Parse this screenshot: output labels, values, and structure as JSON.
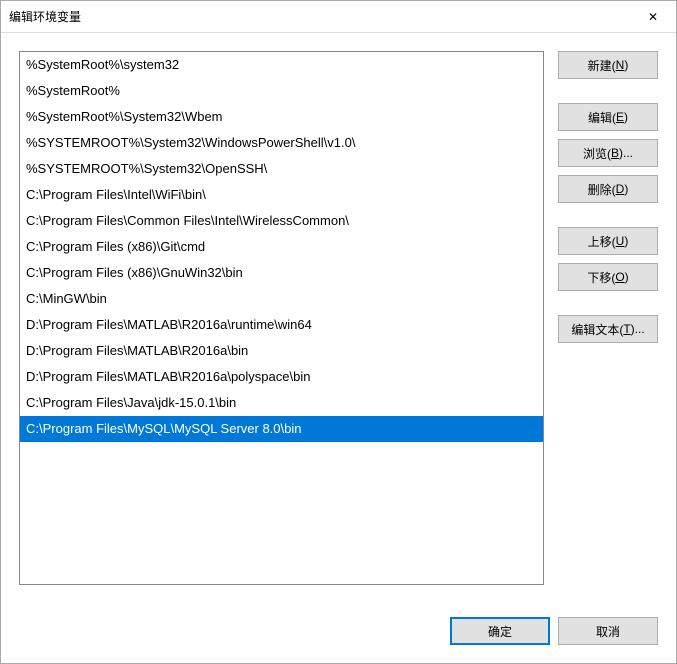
{
  "title": "编辑环境变量",
  "list": [
    "%SystemRoot%\\system32",
    "%SystemRoot%",
    "%SystemRoot%\\System32\\Wbem",
    "%SYSTEMROOT%\\System32\\WindowsPowerShell\\v1.0\\",
    "%SYSTEMROOT%\\System32\\OpenSSH\\",
    "C:\\Program Files\\Intel\\WiFi\\bin\\",
    "C:\\Program Files\\Common Files\\Intel\\WirelessCommon\\",
    "C:\\Program Files (x86)\\Git\\cmd",
    "C:\\Program Files (x86)\\GnuWin32\\bin",
    "C:\\MinGW\\bin",
    "D:\\Program Files\\MATLAB\\R2016a\\runtime\\win64",
    "D:\\Program Files\\MATLAB\\R2016a\\bin",
    "D:\\Program Files\\MATLAB\\R2016a\\polyspace\\bin",
    "C:\\Program Files\\Java\\jdk-15.0.1\\bin",
    "C:\\Program Files\\MySQL\\MySQL Server 8.0\\bin"
  ],
  "selected_index": 14,
  "buttons": {
    "new": {
      "label": "新建(",
      "key": "N",
      "after": ")"
    },
    "edit": {
      "label": "编辑(",
      "key": "E",
      "after": ")"
    },
    "browse": {
      "label": "浏览(",
      "key": "B",
      "after": ")..."
    },
    "delete": {
      "label": "删除(",
      "key": "D",
      "after": ")"
    },
    "moveup": {
      "label": "上移(",
      "key": "U",
      "after": ")"
    },
    "movedown": {
      "label": "下移(",
      "key": "O",
      "after": ")"
    },
    "edittext": {
      "label": "编辑文本(",
      "key": "T",
      "after": ")..."
    }
  },
  "footer": {
    "ok": "确定",
    "cancel": "取消"
  }
}
